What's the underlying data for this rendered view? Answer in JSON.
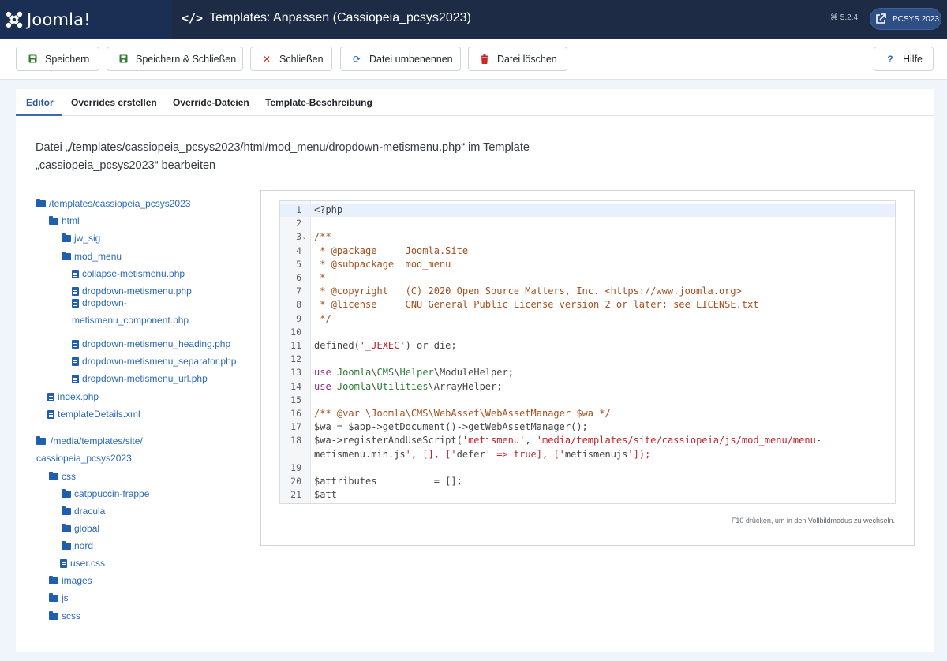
{
  "header": {
    "brand": "Joomla!",
    "title": "Templates: Anpassen (Cassiopeia_pcsys2023)",
    "version": "5.2.4",
    "site_button": "PCSYS 2023"
  },
  "toolbar": {
    "save": "Speichern",
    "save_close": "Speichern & Schließen",
    "close": "Schließen",
    "rename": "Datei umbenennen",
    "delete": "Datei löschen",
    "help": "Hilfe"
  },
  "tabs": [
    "Editor",
    "Overrides erstellen",
    "Override-Dateien",
    "Template-Beschreibung"
  ],
  "file_heading": {
    "line1": "Datei „/templates/cassiopeia_pcsys2023/html/mod_menu/dropdown-metismenu.php“ im Template",
    "line2": "„cassiopeia_pcsys2023“ bearbeiten"
  },
  "tree": [
    {
      "label": "/templates/cassiopeia_pcsys2023",
      "type": "folder"
    },
    {
      "label": "html",
      "type": "folder"
    },
    {
      "label": "jw_sig",
      "type": "folder"
    },
    {
      "label": "mod_menu",
      "type": "folder"
    },
    {
      "label": "collapse-metismenu.php",
      "type": "file"
    },
    {
      "label": "dropdown-metismenu.php",
      "type": "file"
    },
    {
      "label": "dropdown-",
      "label2": "metismenu_component.php",
      "type": "file"
    },
    {
      "label": "dropdown-metismenu_heading.php",
      "type": "file"
    },
    {
      "label": "dropdown-metismenu_separator.php",
      "type": "file"
    },
    {
      "label": "dropdown-metismenu_url.php",
      "type": "file"
    },
    {
      "label": "index.php",
      "type": "file"
    },
    {
      "label": "templateDetails.xml",
      "type": "file"
    },
    {
      "label": "/media/templates/site/",
      "label2": "cassiopeia_pcsys2023",
      "type": "folder"
    },
    {
      "label": "css",
      "type": "folder"
    },
    {
      "label": "catppuccin-frappe",
      "type": "folder"
    },
    {
      "label": "dracula",
      "type": "folder"
    },
    {
      "label": "global",
      "type": "folder"
    },
    {
      "label": "nord",
      "type": "folder"
    },
    {
      "label": "user.css",
      "type": "file"
    },
    {
      "label": "images",
      "type": "folder"
    },
    {
      "label": "js",
      "type": "folder"
    },
    {
      "label": "scss",
      "type": "folder"
    }
  ],
  "editor": {
    "hint": "F10 drücken, um in den Vollbildmodus zu wechseln.",
    "lines": [
      "<?php",
      "",
      "/**",
      " * @package     Joomla.Site",
      " * @subpackage  mod_menu",
      " *",
      " * @copyright   (C) 2020 Open Source Matters, Inc. <https://www.joomla.org>",
      " * @license     GNU General Public License version 2 or later; see LICENSE.txt",
      " */",
      "",
      "defined('_JEXEC') or die;",
      "",
      "use Joomla\\CMS\\Helper\\ModuleHelper;",
      "use Joomla\\Utilities\\ArrayHelper;",
      "",
      "/** @var \\Joomla\\CMS\\WebAsset\\WebAssetManager $wa */",
      "$wa = $app->getDocument()->getWebAssetManager();",
      "$wa->registerAndUseScript('metismenu', 'media/templates/site/cassiopeia/js/mod_menu/menu-metismenu.min.js', [], ['defer' => true], ['metismenujs']);",
      "",
      "$attributes          = [];",
      "$attributes['class'] = 'mod-menu mod-menu_dropdown-metismenu metismenu mod-list ' . $class_sfx;"
    ]
  },
  "colors": {
    "header_bg": "#1e2b45",
    "brand_bg": "#1b2e54",
    "link": "#2a69b8",
    "save_icon": "#2f7d32",
    "danger_icon": "#c52827"
  }
}
